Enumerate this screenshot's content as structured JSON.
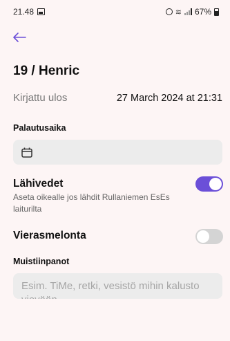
{
  "status_bar": {
    "time": "21.48",
    "battery": "67%"
  },
  "header": {
    "title": "19 / Henric"
  },
  "logged_out": {
    "label": "Kirjattu ulos",
    "value": "27 March 2024 at 21:31"
  },
  "return_time": {
    "label": "Palautusaika",
    "value": ""
  },
  "home_waters": {
    "title": "Lähivedet",
    "description": "Aseta oikealle jos lähdit Rullaniemen EsEs laiturilta",
    "enabled": true
  },
  "guest_paddling": {
    "title": "Vierasmelonta",
    "enabled": false
  },
  "notes": {
    "label": "Muistiinpanot",
    "placeholder": "Esim. TiMe, retki, vesistö mihin kalusto vievään"
  },
  "colors": {
    "accent": "#6b4fd8",
    "background": "#fdf5f5",
    "field": "#ececec"
  }
}
